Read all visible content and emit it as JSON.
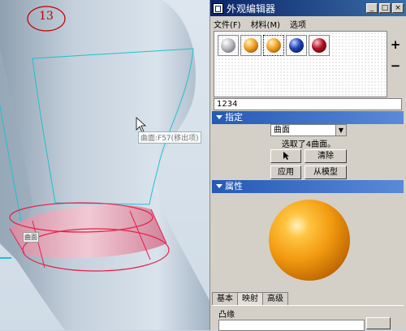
{
  "viewport": {
    "step_number": "13",
    "tooltip": "曲面:F57(移出项)",
    "surface_tag": "曲面",
    "colors": {
      "model": "#c7d3de",
      "highlight": "#e8204a",
      "edges": "#20c0d0"
    }
  },
  "dialog": {
    "title": "外观编辑器",
    "window_buttons": [
      "_",
      "□",
      "×"
    ],
    "menu": [
      "文件(F)",
      "材料(M)",
      "选项"
    ],
    "swatches": [
      {
        "name": "grey",
        "color": "#b8b8c0"
      },
      {
        "name": "orange",
        "color": "#f0a020"
      },
      {
        "name": "orange-2",
        "color": "#f0a020"
      },
      {
        "name": "blue",
        "color": "#1a3fb0"
      },
      {
        "name": "red",
        "color": "#b01020"
      }
    ],
    "side_tools": [
      "+",
      "−"
    ],
    "name_value": "1234",
    "assign": {
      "header": "指定",
      "dropdown_value": "曲面",
      "status": "选取了4曲面。",
      "clear_label": "清除",
      "apply_label": "应用",
      "from_model_label": "从模型"
    },
    "properties": {
      "header": "属性",
      "preview_color": "#f29a10"
    },
    "tabs": [
      "基本",
      "映射",
      "高级"
    ],
    "active_tab": "映射",
    "group_label": "凸缘"
  }
}
